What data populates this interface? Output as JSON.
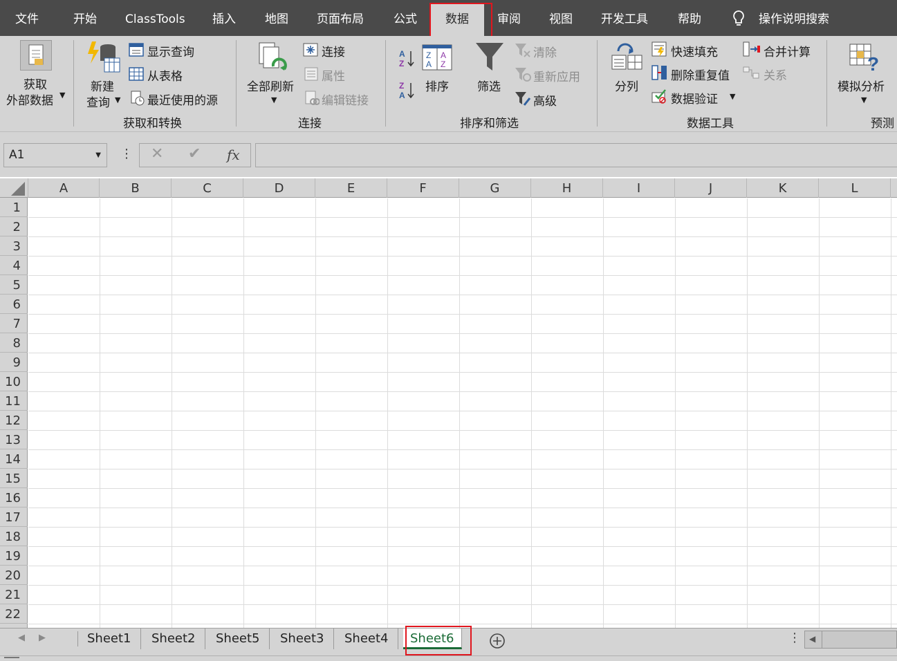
{
  "menu": {
    "tabs": [
      "文件",
      "开始",
      "ClassTools",
      "插入",
      "地图",
      "页面布局",
      "公式",
      "数据",
      "审阅",
      "视图",
      "开发工具",
      "帮助"
    ],
    "active_tab": "数据",
    "search_label": "操作说明搜索"
  },
  "ribbon": {
    "get_external_data": {
      "line1": "获取",
      "line2": "外部数据"
    },
    "new_query": {
      "line1": "新建",
      "line2": "查询"
    },
    "show_queries": "显示查询",
    "from_table": "从表格",
    "recent_sources": "最近使用的源",
    "group_get_transform": "获取和转换",
    "refresh_all": "全部刷新",
    "connections": "连接",
    "properties": "属性",
    "edit_links": "编辑链接",
    "group_connections": "连接",
    "sort": "排序",
    "filter": "筛选",
    "clear": "清除",
    "reapply": "重新应用",
    "advanced": "高级",
    "group_sort_filter": "排序和筛选",
    "text_to_columns": "分列",
    "flash_fill": "快速填充",
    "remove_duplicates": "删除重复值",
    "data_validation": "数据验证",
    "consolidate": "合并计算",
    "relationships": "关系",
    "group_data_tools": "数据工具",
    "what_if": "模拟分析",
    "group_forecast": "预测"
  },
  "formula_bar": {
    "name_box": "A1",
    "fx": "fx",
    "value": ""
  },
  "columns": [
    "A",
    "B",
    "C",
    "D",
    "E",
    "F",
    "G",
    "H",
    "I",
    "J",
    "K",
    "L"
  ],
  "rows": [
    "1",
    "2",
    "3",
    "4",
    "5",
    "6",
    "7",
    "8",
    "9",
    "10",
    "11",
    "12",
    "13",
    "14",
    "15",
    "16",
    "17",
    "18",
    "19",
    "20",
    "21",
    "22"
  ],
  "sheets": [
    "Sheet1",
    "Sheet2",
    "Sheet5",
    "Sheet3",
    "Sheet4",
    "Sheet6"
  ],
  "active_sheet": "Sheet6",
  "colors": {
    "accent_green": "#1a6b36",
    "highlight_red": "#e0161e",
    "ribbon_bg": "#d4d4d4",
    "menu_bg": "#4a4a4a"
  }
}
